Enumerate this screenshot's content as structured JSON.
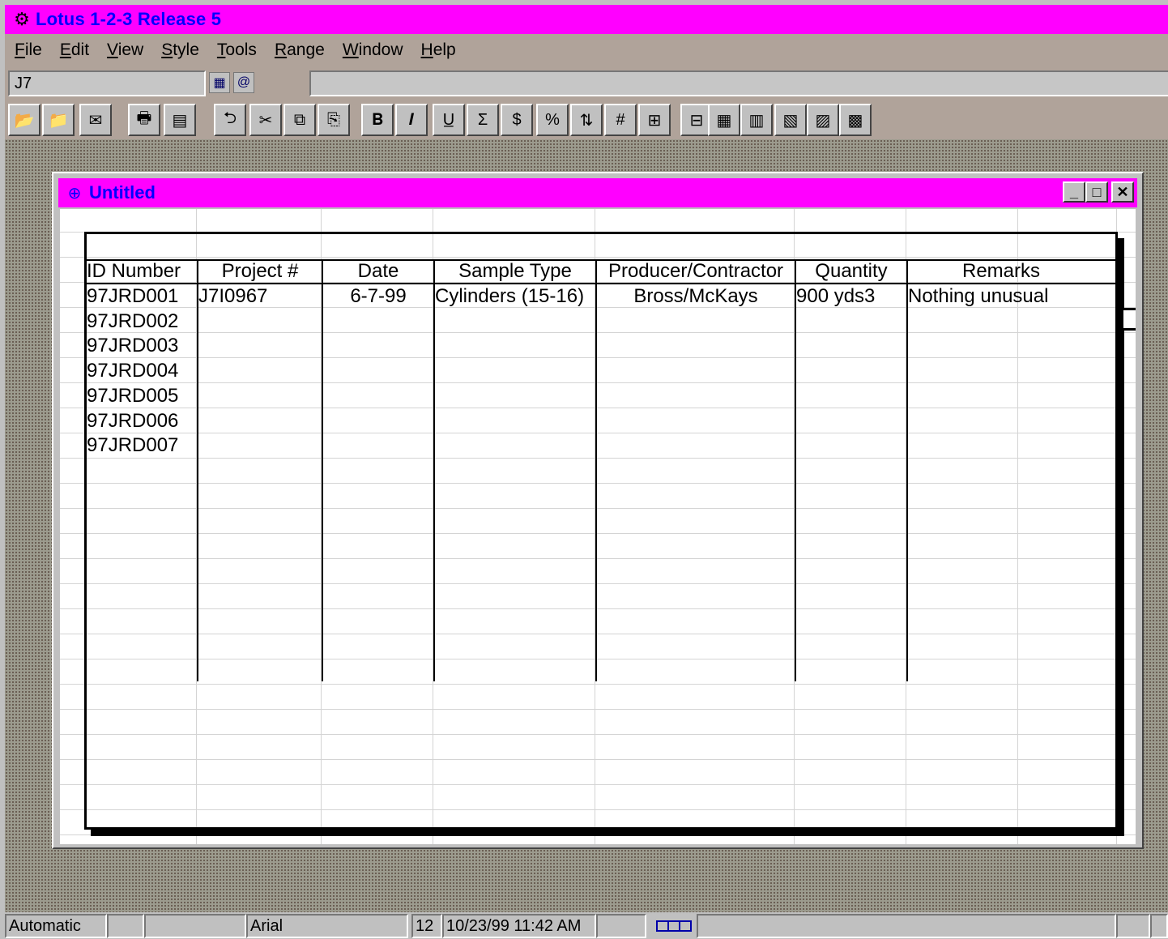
{
  "app": {
    "title": "Lotus 1-2-3 Release 5",
    "icon": "lotus-app-icon"
  },
  "menu": [
    "File",
    "Edit",
    "View",
    "Style",
    "Tools",
    "Range",
    "Window",
    "Help"
  ],
  "formula_bar": {
    "cell_address": "J7",
    "navigator_icon": "navigator-icon",
    "function_icon": "at-function-icon",
    "contents": ""
  },
  "toolbar": {
    "buttons": [
      {
        "name": "open-file-icon",
        "glyph": "📂"
      },
      {
        "name": "save-file-icon",
        "glyph": "📁"
      },
      {
        "name": "mail-icon",
        "glyph": "✉"
      },
      {
        "name": "print-icon",
        "glyph": "🖶"
      },
      {
        "name": "print-preview-icon",
        "glyph": "▤"
      },
      {
        "name": "undo-icon",
        "glyph": "⮌"
      },
      {
        "name": "cut-icon",
        "glyph": "✂"
      },
      {
        "name": "copy-icon",
        "glyph": "⧉"
      },
      {
        "name": "paste-icon",
        "glyph": "⎘"
      },
      {
        "name": "bold-icon",
        "glyph": "𝐁"
      },
      {
        "name": "italic-icon",
        "glyph": "𝑰"
      },
      {
        "name": "underline-icon",
        "glyph": "U̲"
      },
      {
        "name": "sum-icon",
        "glyph": "Σ"
      },
      {
        "name": "currency-icon",
        "glyph": "$"
      },
      {
        "name": "percent-icon",
        "glyph": "%"
      },
      {
        "name": "sort-icon",
        "glyph": "⇅"
      },
      {
        "name": "number-format-icon",
        "glyph": "#"
      },
      {
        "name": "insert-row-icon",
        "glyph": "⊞"
      },
      {
        "name": "insert-column-icon",
        "glyph": "⊟"
      },
      {
        "name": "delete-row-icon",
        "glyph": "▦"
      },
      {
        "name": "delete-column-icon",
        "glyph": "▥"
      },
      {
        "name": "insert-sheet-icon",
        "glyph": "▧"
      },
      {
        "name": "delete-sheet-icon",
        "glyph": "▨"
      },
      {
        "name": "chart-icon",
        "glyph": "▩"
      }
    ]
  },
  "document": {
    "title": "Untitled",
    "icon": "worksheet-icon",
    "minimize": "_",
    "maximize": "□",
    "close": "✕"
  },
  "table": {
    "headers": [
      "ID Number",
      "Project #",
      "Date",
      "Sample Type",
      "Producer/Contractor",
      "Quantity",
      "Remarks"
    ],
    "rows": [
      [
        "97JRD001",
        "J7I0967",
        "6-7-99",
        "Cylinders (15-16)",
        "Bross/McKays",
        "900 yds3",
        "Nothing unusual"
      ],
      [
        "97JRD002",
        "",
        "",
        "",
        "",
        "",
        ""
      ],
      [
        "97JRD003",
        "",
        "",
        "",
        "",
        "",
        ""
      ],
      [
        "97JRD004",
        "",
        "",
        "",
        "",
        "",
        ""
      ],
      [
        "97JRD005",
        "",
        "",
        "",
        "",
        "",
        ""
      ],
      [
        "97JRD006",
        "",
        "",
        "",
        "",
        "",
        ""
      ],
      [
        "97JRD007",
        "",
        "",
        "",
        "",
        "",
        ""
      ]
    ]
  },
  "status": {
    "mode": "Automatic",
    "font": "Arial",
    "font_size": "12",
    "datetime": "10/23/99 11:42 AM"
  },
  "colors": {
    "titlebar": "#ff00ff",
    "title_text": "#0000ff",
    "chrome": "#b0a39a",
    "face": "#c0c0c0"
  }
}
